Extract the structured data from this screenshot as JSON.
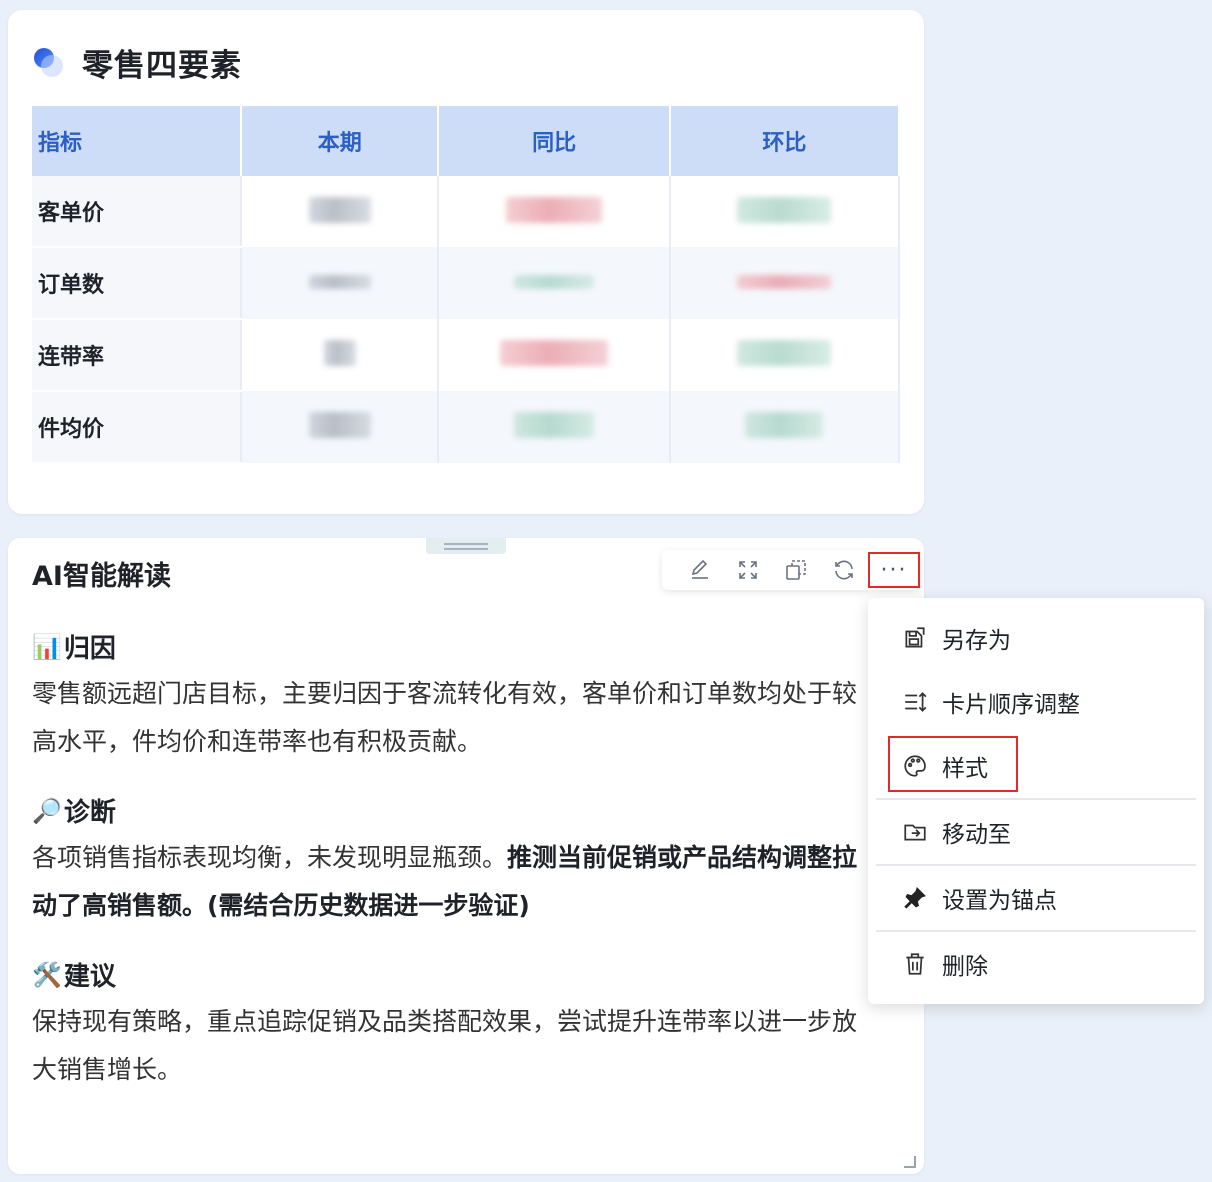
{
  "retail_card": {
    "title": "零售四要素",
    "table": {
      "headers": [
        "指标",
        "本期",
        "同比",
        "环比"
      ],
      "rows": [
        {
          "label": "客单价",
          "current": "",
          "yoy": "",
          "mom": ""
        },
        {
          "label": "订单数",
          "current": "",
          "yoy": "",
          "mom": ""
        },
        {
          "label": "连带率",
          "current": "",
          "yoy": "",
          "mom": ""
        },
        {
          "label": "件均价",
          "current": "",
          "yoy": "",
          "mom": ""
        }
      ]
    }
  },
  "ai_card": {
    "title": "AI智能解读",
    "toolbar": {
      "icons": [
        "edit-icon",
        "expand-icon",
        "copy-icon",
        "refresh-icon",
        "more-icon"
      ],
      "more_label": "···"
    },
    "sections": [
      {
        "emoji": "📊",
        "heading": "归因",
        "text": "零售额远超门店目标，主要归因于客流转化有效，客单价和订单数均处于较高水平，件均价和连带率也有积极贡献。"
      },
      {
        "emoji": "🔎",
        "heading": "诊断",
        "text": "各项销售指标表现均衡，未发现明显瓶颈。",
        "bold_text": "推测当前促销或产品结构调整拉动了高销售额。(需结合历史数据进一步验证)"
      },
      {
        "emoji": "🛠️",
        "heading": "建议",
        "text": "保持现有策略，重点追踪促销及品类搭配效果，尝试提升连带率以进一步放大销售增长。"
      }
    ]
  },
  "context_menu": {
    "items": [
      {
        "label": "另存为",
        "icon": "save-as-icon"
      },
      {
        "label": "卡片顺序调整",
        "icon": "reorder-icon"
      },
      {
        "label": "样式",
        "icon": "palette-icon"
      },
      {
        "label": "移动至",
        "icon": "move-to-icon"
      },
      {
        "label": "设置为锚点",
        "icon": "pin-icon"
      },
      {
        "label": "删除",
        "icon": "trash-icon"
      }
    ]
  },
  "colors": {
    "page_bg": "#eaf0f9",
    "header_bg": "#cddcf7",
    "header_text": "#2b5fc4",
    "highlight_border": "#e02b2b"
  }
}
